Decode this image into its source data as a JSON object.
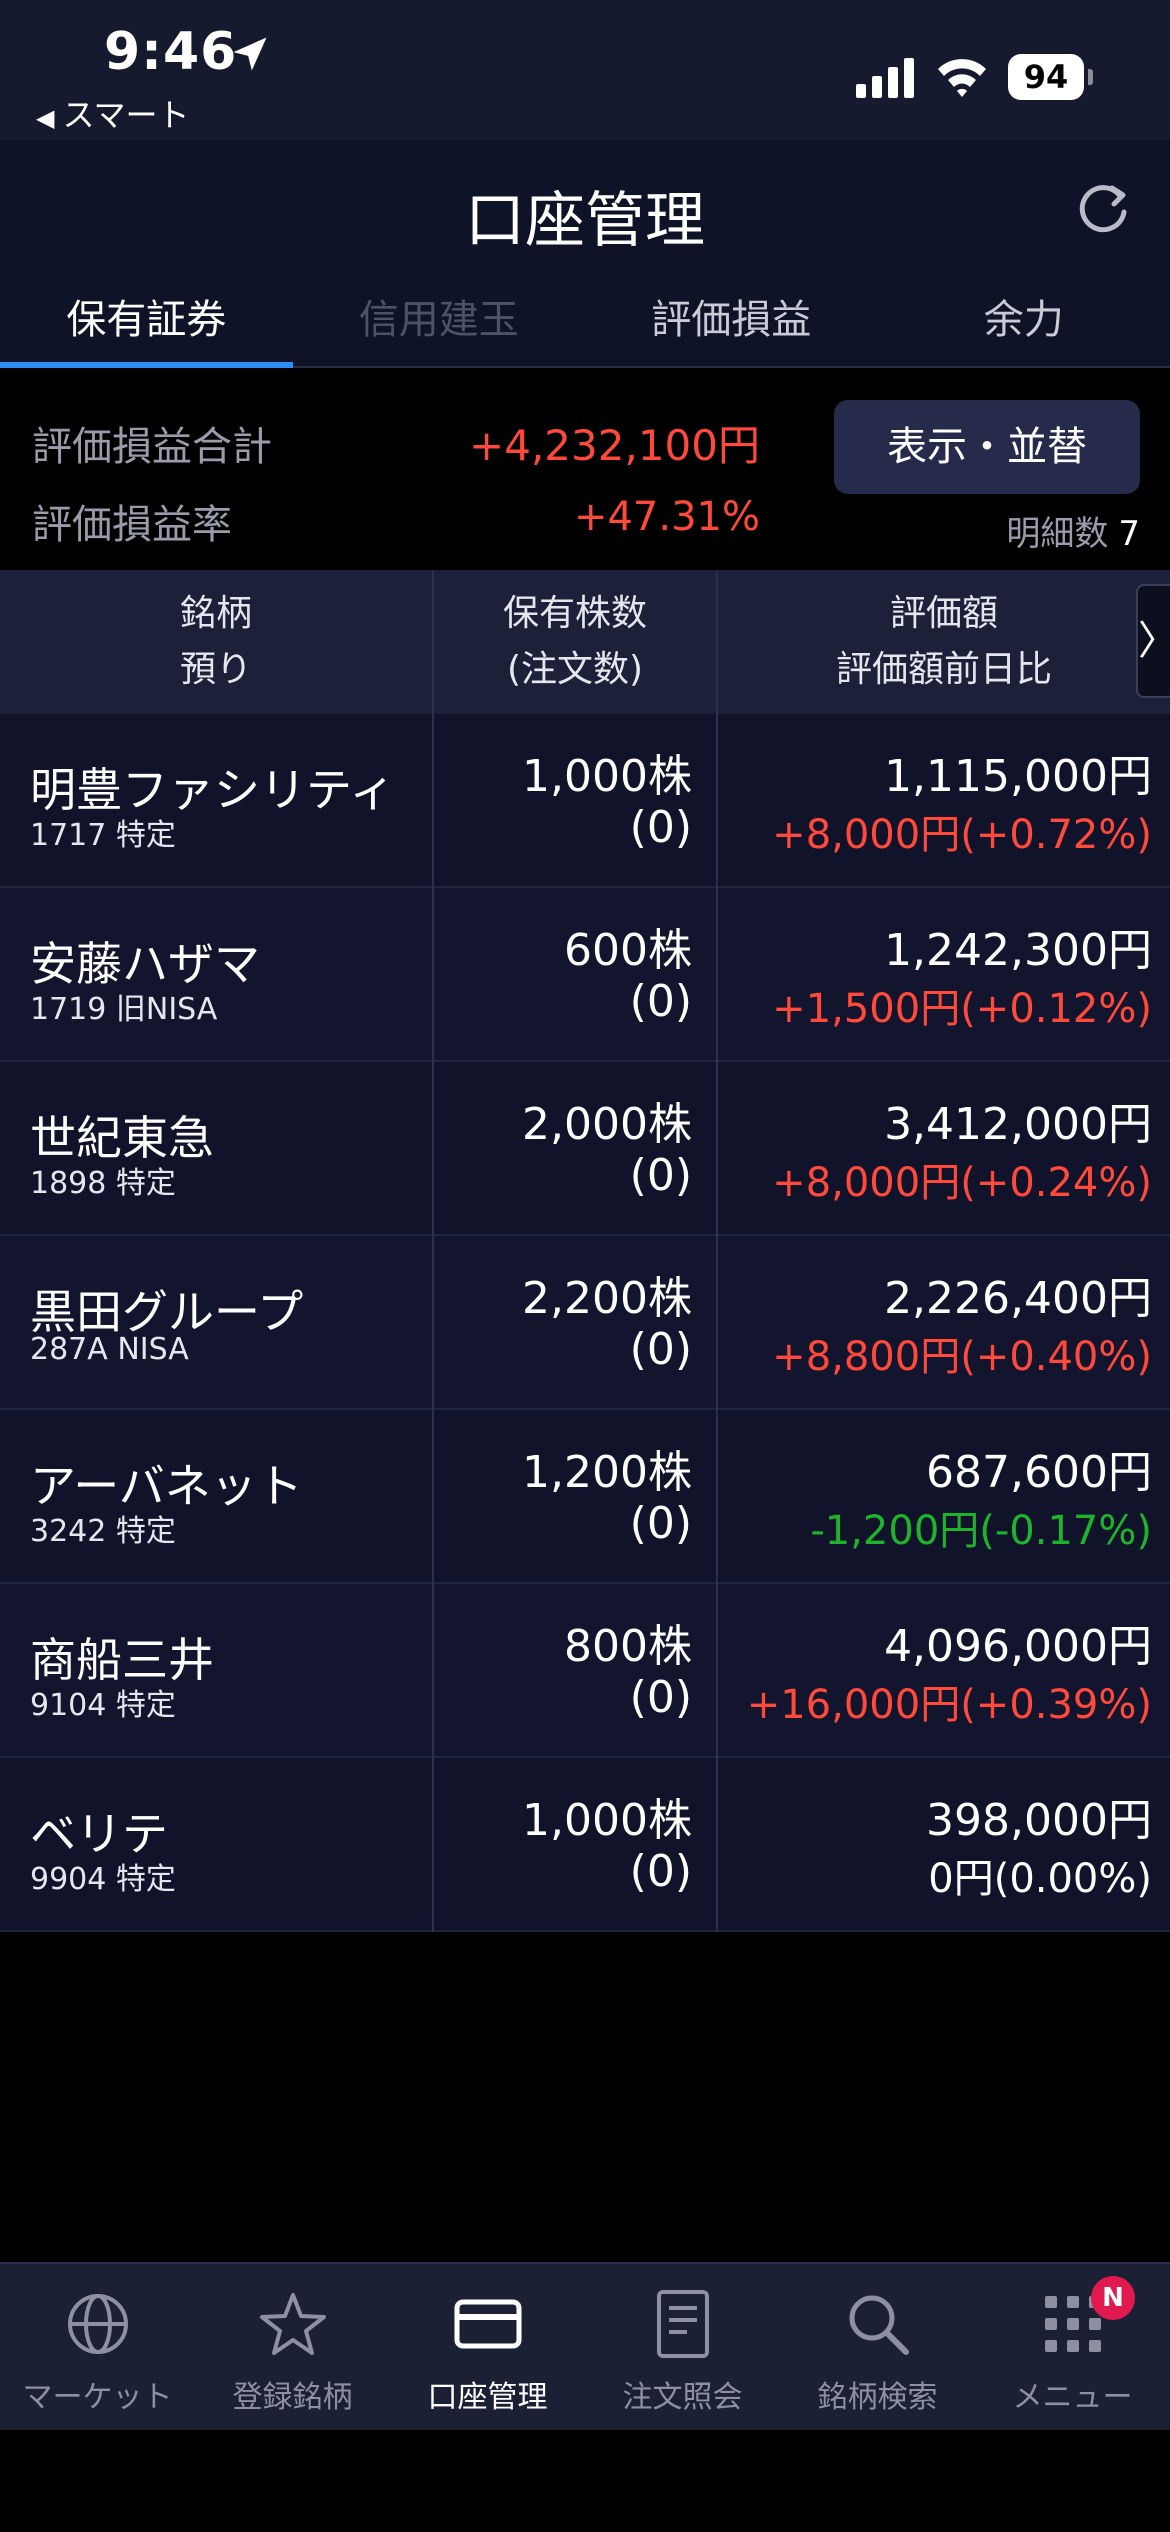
{
  "status_bar": {
    "time": "9:46",
    "back_app": "スマート",
    "battery": "94",
    "icons": [
      "location-arrow-icon",
      "cellular-signal-icon",
      "wifi-icon",
      "battery-icon"
    ]
  },
  "header": {
    "title": "口座管理",
    "refresh_icon": "refresh-icon"
  },
  "tabs": [
    {
      "label": "保有証券",
      "state": "active"
    },
    {
      "label": "信用建玉",
      "state": "disabled"
    },
    {
      "label": "評価損益",
      "state": "normal"
    },
    {
      "label": "余力",
      "state": "normal"
    }
  ],
  "summary": {
    "total_label": "評価損益合計",
    "total_value": "+4,232,100円",
    "rate_label": "評価損益率",
    "rate_value": "+47.31%",
    "display_button": "表示・並替",
    "detail_label": "明細数",
    "detail_count": "7"
  },
  "table": {
    "headers": {
      "col1_line1": "銘柄",
      "col1_line2": "預り",
      "col2_line1": "保有株数",
      "col2_line2": "(注文数)",
      "col3_line1": "評価額",
      "col3_line2": "評価額前日比",
      "more": "〉"
    },
    "rows": [
      {
        "name": "明豊ファシリティ",
        "sub": "1717 特定",
        "qty": "1,000株",
        "orders": "(0)",
        "value": "1,115,000円",
        "change": "+8,000円(+0.72%)",
        "trend": "pos"
      },
      {
        "name": "安藤ハザマ",
        "sub": "1719 旧NISA",
        "qty": "600株",
        "orders": "(0)",
        "value": "1,242,300円",
        "change": "+1,500円(+0.12%)",
        "trend": "pos"
      },
      {
        "name": "世紀東急",
        "sub": "1898 特定",
        "qty": "2,000株",
        "orders": "(0)",
        "value": "3,412,000円",
        "change": "+8,000円(+0.24%)",
        "trend": "pos"
      },
      {
        "name": "黒田グループ",
        "sub": "287A NISA",
        "qty": "2,200株",
        "orders": "(0)",
        "value": "2,226,400円",
        "change": "+8,800円(+0.40%)",
        "trend": "pos"
      },
      {
        "name": "アーバネット",
        "sub": "3242 特定",
        "qty": "1,200株",
        "orders": "(0)",
        "value": "687,600円",
        "change": "-1,200円(-0.17%)",
        "trend": "neg"
      },
      {
        "name": "商船三井",
        "sub": "9104 特定",
        "qty": "800株",
        "orders": "(0)",
        "value": "4,096,000円",
        "change": "+16,000円(+0.39%)",
        "trend": "pos"
      },
      {
        "name": "ベリテ",
        "sub": "9904 特定",
        "qty": "1,000株",
        "orders": "(0)",
        "value": "398,000円",
        "change": "0円(0.00%)",
        "trend": "zero"
      }
    ]
  },
  "bottom_nav": [
    {
      "label": "マーケット",
      "icon": "globe-icon",
      "active": false
    },
    {
      "label": "登録銘柄",
      "icon": "star-icon",
      "active": false
    },
    {
      "label": "口座管理",
      "icon": "card-icon",
      "active": true
    },
    {
      "label": "注文照会",
      "icon": "document-icon",
      "active": false
    },
    {
      "label": "銘柄検索",
      "icon": "search-icon",
      "active": false
    },
    {
      "label": "メニュー",
      "icon": "grid-menu-icon",
      "active": false,
      "badge": "N"
    }
  ],
  "colors": {
    "positive": "#ff4a3b",
    "negative": "#1fb32c",
    "accent": "#2f8ef5",
    "header_bg": "#0f1328",
    "badge": "#e01a4f"
  }
}
